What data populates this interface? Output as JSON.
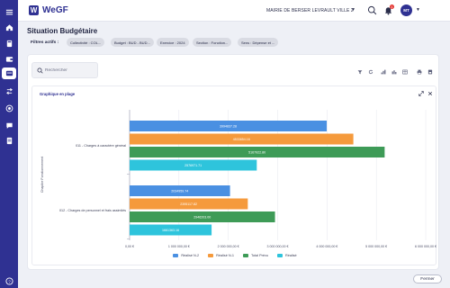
{
  "app": {
    "logo_letter": "W",
    "logo_text": "WeGF",
    "mairie": "MAIRIE DE BERSER LEVRAULT VILLE 2",
    "notifications": "1",
    "avatar_initials": "MT"
  },
  "page": {
    "title": "Situation Budgétaire",
    "filters_label": "Filtres actifs :"
  },
  "filters": [
    "Collectivité : COL...",
    "Budget : BUD - BUD...",
    "Exercice : 2024",
    "Section : Fonction...",
    "Sens : Dépense et ..."
  ],
  "search": {
    "placeholder": "Rechercher"
  },
  "chart_panel": {
    "title": "Graphique en plage"
  },
  "buttons": {
    "close": "Fermer"
  },
  "colors": {
    "brand": "#2f3192",
    "realise_n2": "#4a90e2",
    "realise_n1": "#f59a3c",
    "total_prevu": "#3e9b57",
    "realise": "#2ec4dc"
  },
  "chart_data": {
    "type": "bar",
    "orientation": "horizontal",
    "categories": [
      "011 - Charges à caractère général",
      "012 - Charges de personnel et frais assimilés"
    ],
    "series": [
      {
        "name": "Réalisé N-2",
        "values": [
          3994837.28,
          2034959.74
        ],
        "labels": [
          "3994837.28",
          "2034959.74"
        ]
      },
      {
        "name": "Réalisé N-1",
        "values": [
          4533854.16,
          2395117.82
        ],
        "labels": [
          "4533854.16",
          "2395117.82"
        ]
      },
      {
        "name": "Total Prévu",
        "values": [
          5167922.8,
          2946203.0
        ],
        "labels": [
          "5167922.80",
          "2946203.00"
        ]
      },
      {
        "name": "Réalisé",
        "values": [
          2576971.71,
          1661363.16
        ],
        "labels": [
          "2576971.71",
          "1661363.16"
        ]
      }
    ],
    "x_ticks": [
      "0,00 €",
      "1 000 000,00 €",
      "2 000 000,00 €",
      "3 000 000,00 €",
      "4 000 000,00 €",
      "5 000 000,00 €",
      "6 000 000,00 €"
    ],
    "xlim": [
      0,
      6000000
    ],
    "ylabel": "Chapitre Fonctionnement",
    "grid": true,
    "legend_position": "bottom"
  }
}
